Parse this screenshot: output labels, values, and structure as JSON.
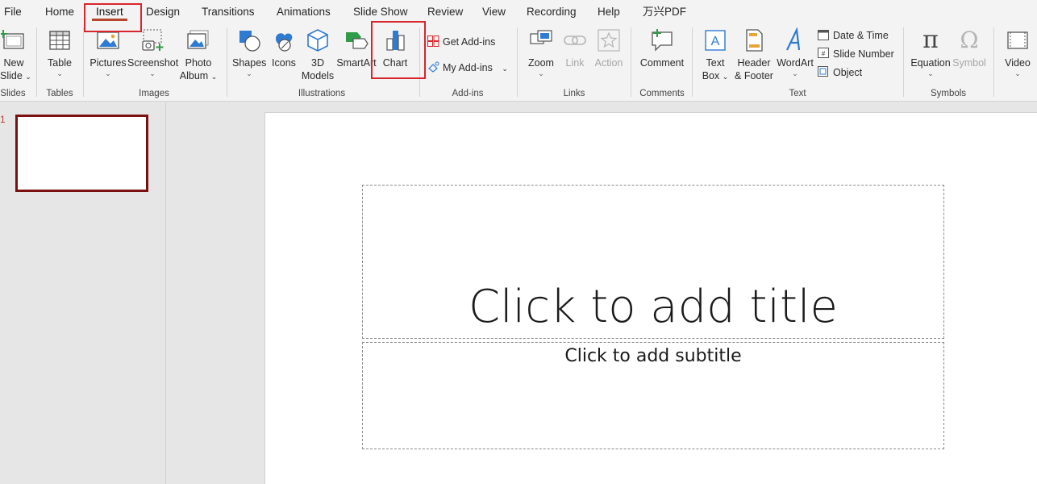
{
  "menu": {
    "tabs": [
      "File",
      "Home",
      "Insert",
      "Design",
      "Transitions",
      "Animations",
      "Slide Show",
      "Review",
      "View",
      "Recording",
      "Help",
      "万兴PDF"
    ],
    "active": "Insert"
  },
  "ribbon": {
    "slides": {
      "new_slide_1": "New",
      "new_slide_2": "Slide",
      "group": "Slides"
    },
    "tables": {
      "table": "Table",
      "group": "Tables"
    },
    "images": {
      "pictures": "Pictures",
      "screenshot": "Screenshot",
      "photo_album_1": "Photo",
      "photo_album_2": "Album",
      "group": "Images"
    },
    "illustrations": {
      "shapes": "Shapes",
      "icons": "Icons",
      "models_1": "3D",
      "models_2": "Models",
      "smartart": "SmartArt",
      "chart": "Chart",
      "group": "Illustrations"
    },
    "addins": {
      "get_addins": "Get Add-ins",
      "my_addins": "My Add-ins",
      "group": "Add-ins"
    },
    "links": {
      "zoom": "Zoom",
      "link": "Link",
      "action": "Action",
      "group": "Links"
    },
    "comments": {
      "comment": "Comment",
      "group": "Comments"
    },
    "text": {
      "textbox_1": "Text",
      "textbox_2": "Box",
      "header_1": "Header",
      "header_2": "& Footer",
      "wordart": "WordArt",
      "date_time": "Date & Time",
      "slide_number": "Slide Number",
      "object": "Object",
      "group": "Text"
    },
    "symbols": {
      "equation": "Equation",
      "symbol": "Symbol",
      "group": "Symbols"
    },
    "media": {
      "video": "Video"
    }
  },
  "thumbnails": {
    "number": "1"
  },
  "slide": {
    "title_placeholder": "Click to add title",
    "subtitle_placeholder": "Click to add subtitle"
  },
  "colors": {
    "accent": "#b7472a",
    "annotation": "#d9262c",
    "selection": "#7b1010",
    "icon_blue": "#2e7bd1"
  }
}
